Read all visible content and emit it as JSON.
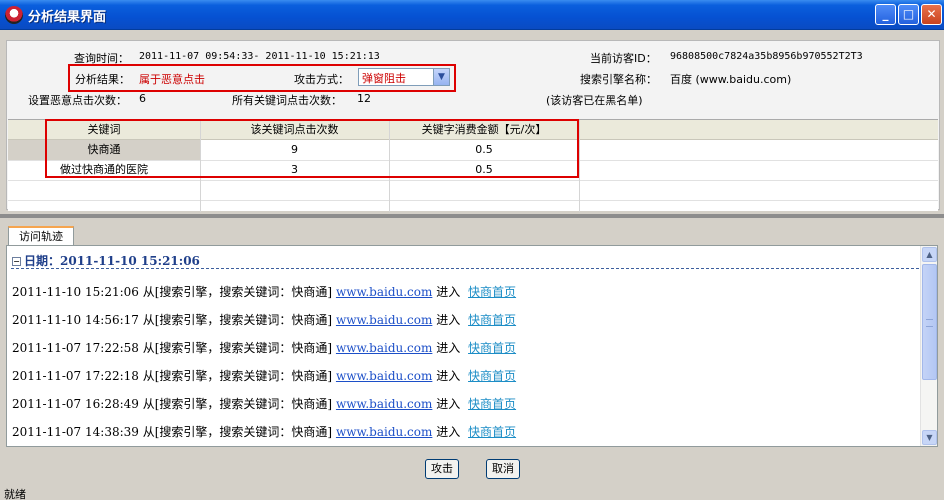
{
  "window": {
    "title": "分析结果界面",
    "min": "_",
    "max": "□",
    "close": "✕"
  },
  "info": {
    "query_time_label": "查询时间：",
    "query_time_value": "2011-11-07 09:54:33- 2011-11-10 15:21:13",
    "result_label": "分析结果：",
    "result_value": "属于恶意点击",
    "attack_mode_label": "攻击方式：",
    "attack_mode_value": "弹窗阻击",
    "set_clicks_label": "设置恶意点击次数：",
    "set_clicks_value": "6",
    "all_clicks_label": "所有关键词点击次数：",
    "all_clicks_value": "12",
    "visitor_id_label": "当前访客ID：",
    "visitor_id_value": "96808500c7824a35b8956b970552T2T3",
    "engine_label": "搜索引擎名称：",
    "engine_value": "百度 (www.baidu.com)",
    "blacklist_note": "(该访客已在黑名单)"
  },
  "keyword_table": {
    "headers": [
      "关键词",
      "该关键词点击次数",
      "关键字消费金额【元/次】"
    ],
    "rows": [
      [
        "快商通",
        "9",
        "0.5"
      ],
      [
        "做过快商通的医院",
        "3",
        "0.5"
      ]
    ]
  },
  "trail": {
    "tab_label": "访问轨迹",
    "date_label": "日期：2011-11-10 15:21:06",
    "source_text": "从[搜索引擎，搜索关键词：快商通]",
    "link_text": "www.baidu.com",
    "enter_text": "进入",
    "page_text": "快商首页",
    "times": [
      "2011-11-10 15:21:06",
      "2011-11-10 14:56:17",
      "2011-11-07 17:22:58",
      "2011-11-07 17:22:18",
      "2011-11-07 16:28:49",
      "2011-11-07 14:38:39"
    ]
  },
  "buttons": {
    "attack": "攻击",
    "cancel": "取消"
  },
  "status": "就绪"
}
